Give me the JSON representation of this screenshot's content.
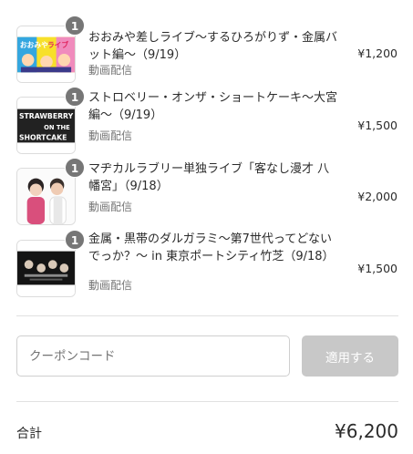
{
  "items": [
    {
      "quantity": "1",
      "title": "おおみや差しライブ〜するひろがりず・金属バット編〜（9/19）",
      "type": "動画配信",
      "price": "¥1,200",
      "thumbnail_text": [
        "おおみや",
        "ライブ"
      ]
    },
    {
      "quantity": "1",
      "title": "ストロベリー・オンザ・ショートケーキ〜大宮編〜（9/19）",
      "type": "動画配信",
      "price": "¥1,500",
      "thumbnail_text": [
        "STRAWBERRY",
        "ON THE",
        "SHORTCAKE"
      ]
    },
    {
      "quantity": "1",
      "title": "マヂカルラブリー単独ライブ「客なし漫才 八幡宮」（9/18）",
      "type": "動画配信",
      "price": "¥2,000",
      "thumbnail_text": []
    },
    {
      "quantity": "1",
      "title": "金属・黒帯のダルガラミ〜第7世代ってどないでっか？〜 in 東京ポートシティ竹芝（9/18）",
      "type": "動画配信",
      "price": "¥1,500",
      "thumbnail_text": []
    }
  ],
  "coupon": {
    "placeholder": "クーポンコード",
    "apply_label": "適用する"
  },
  "total": {
    "label": "合計",
    "value": "¥6,200"
  },
  "colors": {
    "badge": "#767676",
    "apply_button_disabled": "#c8c8c8",
    "divider": "#e1e1e1"
  }
}
